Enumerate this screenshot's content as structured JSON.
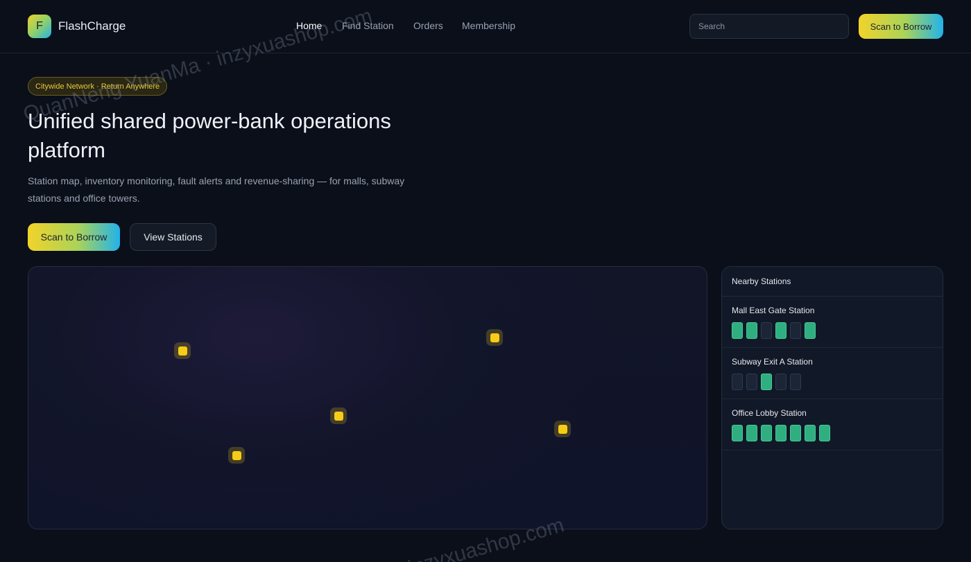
{
  "brand": {
    "logo_letter": "F",
    "name": "FlashCharge"
  },
  "nav": {
    "items": [
      "Home",
      "Find Station",
      "Orders",
      "Membership"
    ],
    "active": "Home"
  },
  "search": {
    "placeholder": "Search"
  },
  "header_cta": "Scan to Borrow",
  "hero": {
    "badge": "Citywide Network · Return Anywhere",
    "title": "Unified shared power-bank operations platform",
    "subtitle": "Station map, inventory monitoring, fault alerts and revenue-sharing — for malls, subway stations and office towers.",
    "primary_cta": "Scan to Borrow",
    "secondary_cta": "View Stations"
  },
  "stations_panel": {
    "title": "Nearby Stations",
    "stations": [
      {
        "name": "Mall East Gate Station",
        "slots": [
          1,
          1,
          0,
          1,
          0,
          1
        ]
      },
      {
        "name": "Subway Exit A Station",
        "slots": [
          0,
          0,
          1,
          0,
          0
        ]
      },
      {
        "name": "Office Lobby Station",
        "slots": [
          1,
          1,
          1,
          1,
          1,
          1,
          1
        ]
      }
    ]
  },
  "watermarks": [
    "QuanNeng YuanMa · inzyxuashop.com",
    "inzyxuashop.com"
  ],
  "colors": {
    "accent_yellow": "#f6cc17",
    "accent_blue": "#22b2ea",
    "slot_full": "#2fae80",
    "background": "#0a0f1a"
  }
}
